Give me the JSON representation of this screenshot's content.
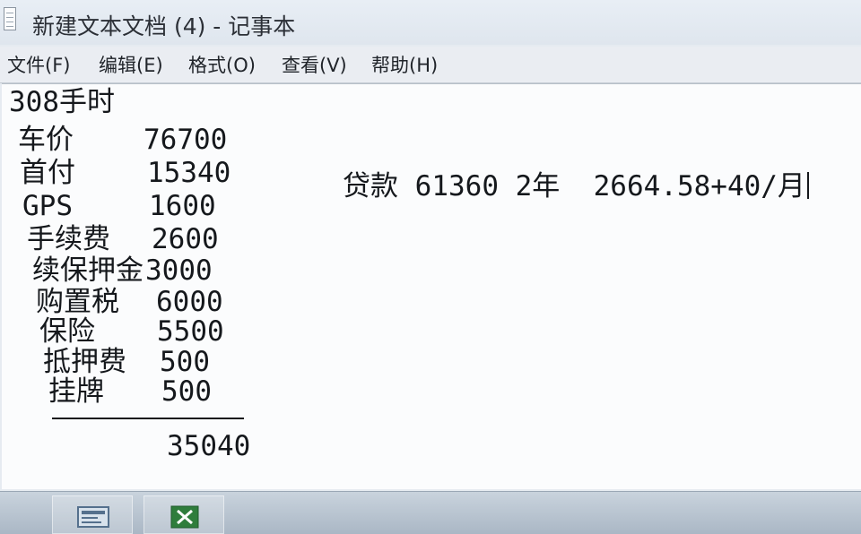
{
  "window": {
    "title": "新建文本文档 (4) - 记事本"
  },
  "menu": [
    "文件(F)",
    "编辑(E)",
    "格式(O)",
    "查看(V)",
    "帮助(H)"
  ],
  "document": {
    "header": "308手时",
    "rows": [
      {
        "label": "车价",
        "value": "76700"
      },
      {
        "label": "首付",
        "value": "15340"
      },
      {
        "label": "GPS",
        "value": "1600"
      },
      {
        "label": "手续费",
        "value": "2600"
      },
      {
        "label": "续保押金",
        "value": "3000"
      },
      {
        "label": "购置税",
        "value": "6000"
      },
      {
        "label": "保险",
        "value": "5500"
      },
      {
        "label": "抵押费",
        "value": "500"
      },
      {
        "label": "挂牌",
        "value": "500"
      }
    ],
    "separator": "————————",
    "total": "35040",
    "loan_note": "贷款 61360 2年  2664.58+40/月"
  },
  "taskbar": {
    "icons": [
      "notepad-window-icon",
      "excel-icon"
    ]
  }
}
